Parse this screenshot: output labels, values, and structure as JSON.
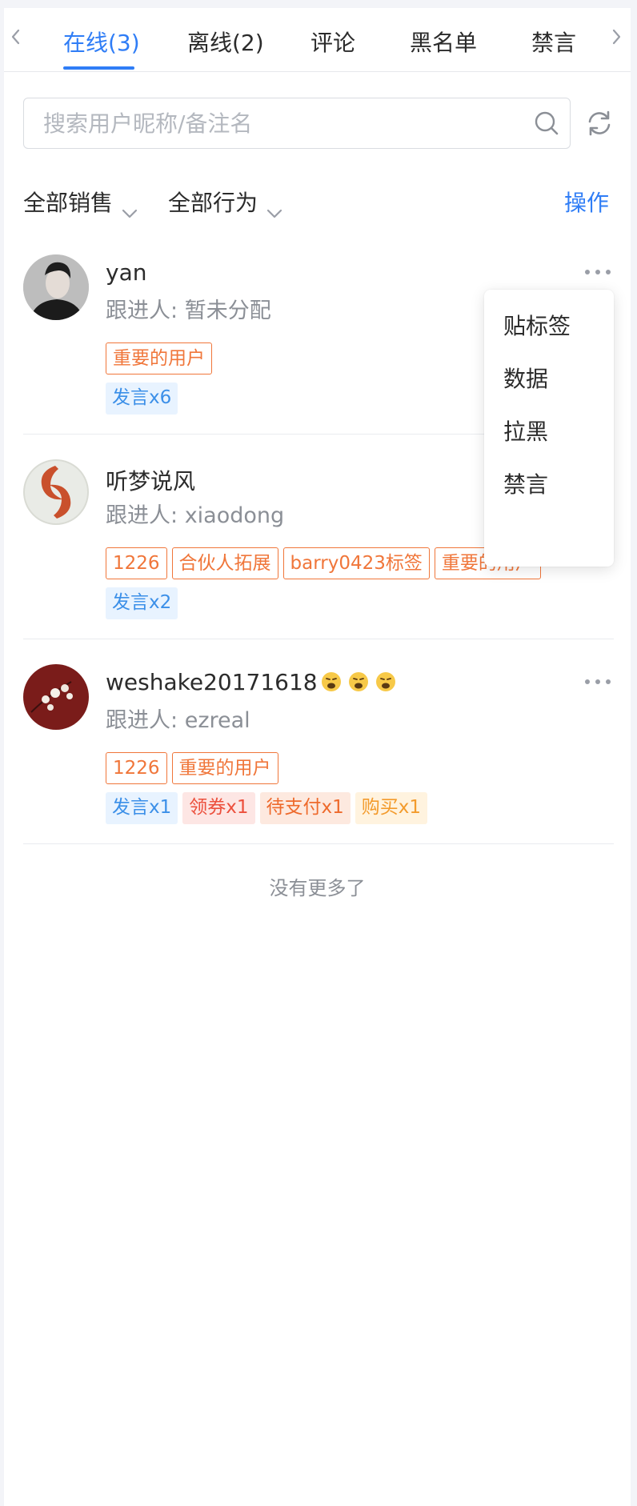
{
  "tabs": [
    {
      "label": "在线(3)",
      "active": true
    },
    {
      "label": "离线(2)",
      "active": false
    },
    {
      "label": "评论",
      "active": false
    },
    {
      "label": "黑名单",
      "active": false
    },
    {
      "label": "禁言",
      "active": false
    }
  ],
  "search": {
    "placeholder": "搜索用户昵称/备注名",
    "value": ""
  },
  "filters": {
    "sales": "全部销售",
    "behavior": "全部行为",
    "action": "操作"
  },
  "users": [
    {
      "name": "yan",
      "follow_label": "跟进人:",
      "follow_value": "暂未分配",
      "tags": [
        "重要的用户"
      ],
      "activity": [
        {
          "label": "发言x6",
          "color": "blue"
        }
      ]
    },
    {
      "name": "听梦说风",
      "follow_label": "跟进人:",
      "follow_value": "xiaodong",
      "tags": [
        "1226",
        "合伙人拓展",
        "barry0423标签",
        "重要的用户"
      ],
      "activity": [
        {
          "label": "发言x2",
          "color": "blue"
        }
      ]
    },
    {
      "name": "weshake20171618",
      "name_emoji": [
        "weary-face",
        "weary-face",
        "weary-face"
      ],
      "follow_label": "跟进人:",
      "follow_value": "ezreal",
      "tags": [
        "1226",
        "重要的用户"
      ],
      "activity": [
        {
          "label": "发言x1",
          "color": "blue"
        },
        {
          "label": "领券x1",
          "color": "red"
        },
        {
          "label": "待支付x1",
          "color": "peach"
        },
        {
          "label": "购买x1",
          "color": "amber"
        }
      ]
    }
  ],
  "menu": {
    "items": [
      "贴标签",
      "数据",
      "拉黑",
      "禁言"
    ]
  },
  "end_note": "没有更多了",
  "colors": {
    "accent": "#2f7df6",
    "tag_outline": "#f0763a",
    "muted": "#8b8f96"
  },
  "icons": [
    "chevron-left-icon",
    "chevron-right-icon",
    "search-icon",
    "refresh-icon",
    "chevron-down-icon",
    "more-icon",
    "weary-face-emoji"
  ]
}
